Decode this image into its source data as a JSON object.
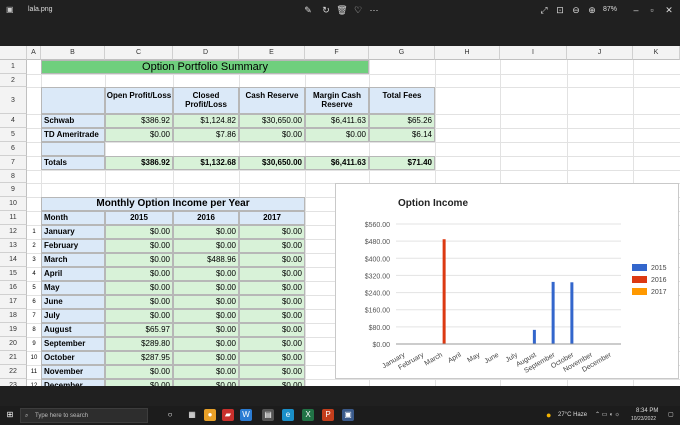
{
  "window": {
    "file_name": "lala.png",
    "zoom": "87%"
  },
  "columns": [
    "A",
    "B",
    "C",
    "D",
    "E",
    "F",
    "G",
    "H",
    "I",
    "J",
    "K"
  ],
  "rows": [
    "1",
    "2",
    "3",
    "4",
    "5",
    "6",
    "7",
    "8",
    "9",
    "10",
    "11",
    "12",
    "13",
    "14",
    "15",
    "16",
    "17",
    "18",
    "19",
    "20",
    "21",
    "22",
    "23"
  ],
  "summary": {
    "title": "Option Portfolio Summary",
    "headers": [
      "Open Profit/Loss",
      "Closed Profit/Loss",
      "Cash Reserve",
      "Margin Cash Reserve",
      "Total Fees"
    ],
    "rows": [
      {
        "label": "Schwab",
        "values": [
          "$386.92",
          "$1,124.82",
          "$30,650.00",
          "$6,411.63",
          "$65.26"
        ]
      },
      {
        "label": "TD Ameritrade",
        "values": [
          "$0.00",
          "$7.86",
          "$0.00",
          "$0.00",
          "$6.14"
        ]
      }
    ],
    "totals": {
      "label": "Totals",
      "values": [
        "$386.92",
        "$1,132.68",
        "$30,650.00",
        "$6,411.63",
        "$71.40"
      ]
    }
  },
  "monthly": {
    "title": "Monthly Option Income per Year",
    "month_header": "Month",
    "years": [
      "2015",
      "2016",
      "2017"
    ],
    "rows": [
      {
        "n": "1",
        "month": "January",
        "values": [
          "$0.00",
          "$0.00",
          "$0.00"
        ]
      },
      {
        "n": "2",
        "month": "February",
        "values": [
          "$0.00",
          "$0.00",
          "$0.00"
        ]
      },
      {
        "n": "3",
        "month": "March",
        "values": [
          "$0.00",
          "$488.96",
          "$0.00"
        ]
      },
      {
        "n": "4",
        "month": "April",
        "values": [
          "$0.00",
          "$0.00",
          "$0.00"
        ]
      },
      {
        "n": "5",
        "month": "May",
        "values": [
          "$0.00",
          "$0.00",
          "$0.00"
        ]
      },
      {
        "n": "6",
        "month": "June",
        "values": [
          "$0.00",
          "$0.00",
          "$0.00"
        ]
      },
      {
        "n": "7",
        "month": "July",
        "values": [
          "$0.00",
          "$0.00",
          "$0.00"
        ]
      },
      {
        "n": "8",
        "month": "August",
        "values": [
          "$65.97",
          "$0.00",
          "$0.00"
        ]
      },
      {
        "n": "9",
        "month": "September",
        "values": [
          "$289.80",
          "$0.00",
          "$0.00"
        ]
      },
      {
        "n": "10",
        "month": "October",
        "values": [
          "$287.95",
          "$0.00",
          "$0.00"
        ]
      },
      {
        "n": "11",
        "month": "November",
        "values": [
          "$0.00",
          "$0.00",
          "$0.00"
        ]
      },
      {
        "n": "12",
        "month": "December",
        "values": [
          "$0.00",
          "$0.00",
          "$0.00"
        ]
      }
    ]
  },
  "chart_data": {
    "type": "bar",
    "title": "Option Income",
    "categories": [
      "January",
      "February",
      "March",
      "April",
      "May",
      "June",
      "July",
      "August",
      "September",
      "October",
      "November",
      "December"
    ],
    "series": [
      {
        "name": "2015",
        "color": "#3366cc",
        "values": [
          0,
          0,
          0,
          0,
          0,
          0,
          0,
          65.97,
          289.8,
          287.95,
          0,
          0
        ]
      },
      {
        "name": "2016",
        "color": "#dc3912",
        "values": [
          0,
          0,
          488.96,
          0,
          0,
          0,
          0,
          0,
          0,
          0,
          0,
          0
        ]
      },
      {
        "name": "2017",
        "color": "#ff9900",
        "values": [
          0,
          0,
          0,
          0,
          0,
          0,
          0,
          0,
          0,
          0,
          0,
          0
        ]
      }
    ],
    "yticks": [
      "$0.00",
      "$80.00",
      "$160.00",
      "$240.00",
      "$320.00",
      "$400.00",
      "$480.00",
      "$560.00"
    ],
    "ylim": [
      0,
      560
    ],
    "legend": "right",
    "grid": true
  },
  "taskbar": {
    "search_placeholder": "Type here to search",
    "weather": "27°C  Haze",
    "time": "8:34 PM",
    "date": "10/23/2022"
  }
}
